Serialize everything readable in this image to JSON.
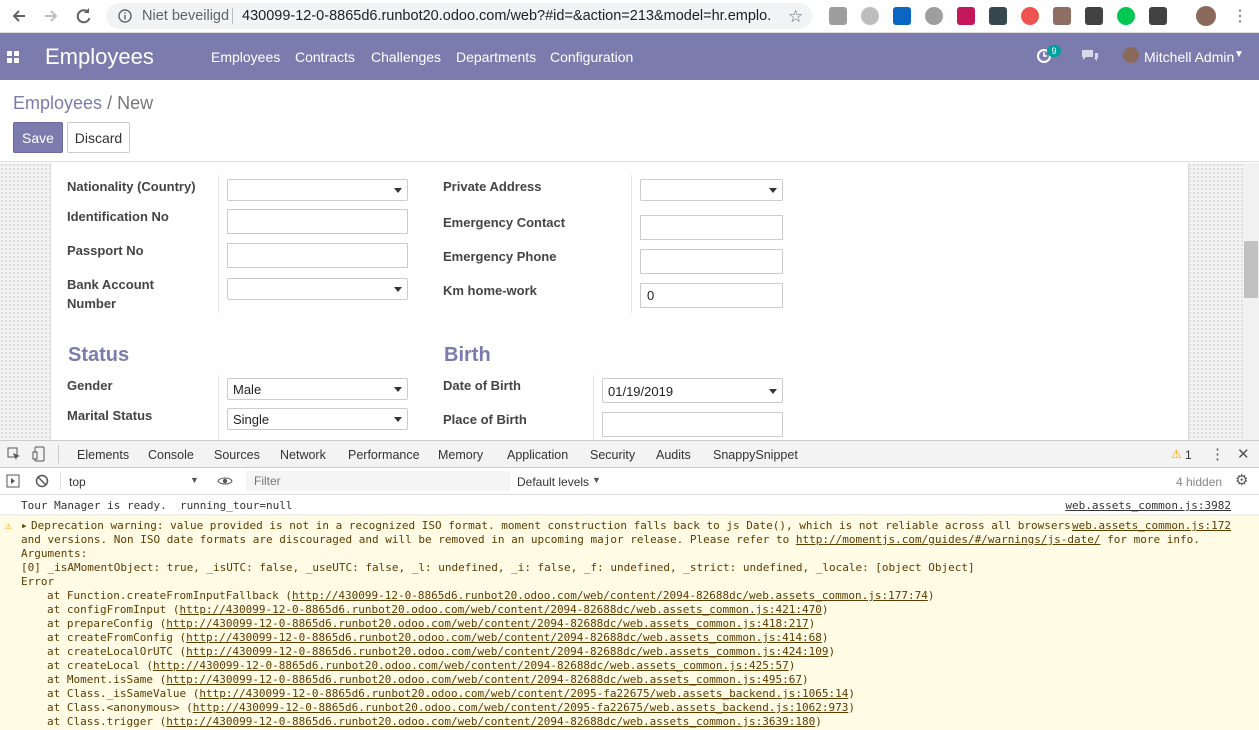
{
  "browser": {
    "secure_label": "Niet beveiligd",
    "url": "430099-12-0-8865d6.runbot20.odoo.com/web?#id=&action=213&model=hr.emplo..."
  },
  "nav": {
    "brand": "Employees",
    "menus": [
      "Employees",
      "Contracts",
      "Challenges",
      "Departments",
      "Configuration"
    ],
    "notification_count": "9",
    "user": "Mitchell Admin",
    "color": "#7c7bad"
  },
  "breadcrumb": {
    "parent": "Employees",
    "separator": "/",
    "current": "New"
  },
  "buttons": {
    "save": "Save",
    "discard": "Discard"
  },
  "form": {
    "left_fields": [
      {
        "label": "Nationality (Country)",
        "value": ""
      },
      {
        "label": "Identification No",
        "value": ""
      },
      {
        "label": "Passport No",
        "value": ""
      },
      {
        "label": "Bank Account Number",
        "value": ""
      }
    ],
    "right_fields": [
      {
        "label": "Private Address",
        "value": ""
      },
      {
        "label": "Emergency Contact",
        "value": ""
      },
      {
        "label": "Emergency Phone",
        "value": ""
      },
      {
        "label": "Km home-work",
        "value": "0"
      }
    ],
    "status": {
      "title": "Status",
      "gender_label": "Gender",
      "gender_value": "Male",
      "marital_label": "Marital Status",
      "marital_value": "Single"
    },
    "birth": {
      "title": "Birth",
      "dob_label": "Date of Birth",
      "dob_value": "01/19/2019",
      "pob_label": "Place of Birth",
      "pob_value": ""
    }
  },
  "devtools": {
    "tabs": [
      "Elements",
      "Console",
      "Sources",
      "Network",
      "Performance",
      "Memory",
      "Application",
      "Security",
      "Audits",
      "SnappySnippet"
    ],
    "active_tab": "Console",
    "warnings_count": "1",
    "context": "top",
    "filter_placeholder": "Filter",
    "levels": "Default levels",
    "hidden": "4 hidden",
    "messages": {
      "tour": "Tour Manager is ready.  running_tour=null",
      "tour_src": "web.assets_common.js:3982",
      "warn_line1": "Deprecation warning: value provided is not in a recognized ISO format. moment construction falls back to js Date(), which is not reliable across all browsers",
      "warn_src": "web.assets_common.js:172",
      "warn_line2a": "and versions. Non ISO date formats are discouraged and will be removed in an upcoming major release. Please refer to ",
      "warn_link": "http://momentjs.com/guides/#/warnings/js-date/",
      "warn_line2b": " for more info.",
      "arguments": "Arguments:",
      "arg0": "[0] _isAMomentObject: true, _isUTC: false, _useUTC: false, _l: undefined, _i: false, _f: undefined, _strict: undefined, _locale: [object Object]",
      "error": "Error",
      "stack": [
        {
          "fn": "at Function.createFromInputFallback (",
          "url": "http://430099-12-0-8865d6.runbot20.odoo.com/web/content/2094-82688dc/web.assets_common.js:177:74"
        },
        {
          "fn": "at configFromInput (",
          "url": "http://430099-12-0-8865d6.runbot20.odoo.com/web/content/2094-82688dc/web.assets_common.js:421:470"
        },
        {
          "fn": "at prepareConfig (",
          "url": "http://430099-12-0-8865d6.runbot20.odoo.com/web/content/2094-82688dc/web.assets_common.js:418:217"
        },
        {
          "fn": "at createFromConfig (",
          "url": "http://430099-12-0-8865d6.runbot20.odoo.com/web/content/2094-82688dc/web.assets_common.js:414:68"
        },
        {
          "fn": "at createLocalOrUTC (",
          "url": "http://430099-12-0-8865d6.runbot20.odoo.com/web/content/2094-82688dc/web.assets_common.js:424:109"
        },
        {
          "fn": "at createLocal (",
          "url": "http://430099-12-0-8865d6.runbot20.odoo.com/web/content/2094-82688dc/web.assets_common.js:425:57"
        },
        {
          "fn": "at Moment.isSame (",
          "url": "http://430099-12-0-8865d6.runbot20.odoo.com/web/content/2094-82688dc/web.assets_common.js:495:67"
        },
        {
          "fn": "at Class._isSameValue (",
          "url": "http://430099-12-0-8865d6.runbot20.odoo.com/web/content/2095-fa22675/web.assets_backend.js:1065:14"
        },
        {
          "fn": "at Class.<anonymous> (",
          "url": "http://430099-12-0-8865d6.runbot20.odoo.com/web/content/2095-fa22675/web.assets_backend.js:1062:973"
        },
        {
          "fn": "at Class.trigger (",
          "url": "http://430099-12-0-8865d6.runbot20.odoo.com/web/content/2094-82688dc/web.assets_common.js:3639:180"
        }
      ]
    }
  }
}
